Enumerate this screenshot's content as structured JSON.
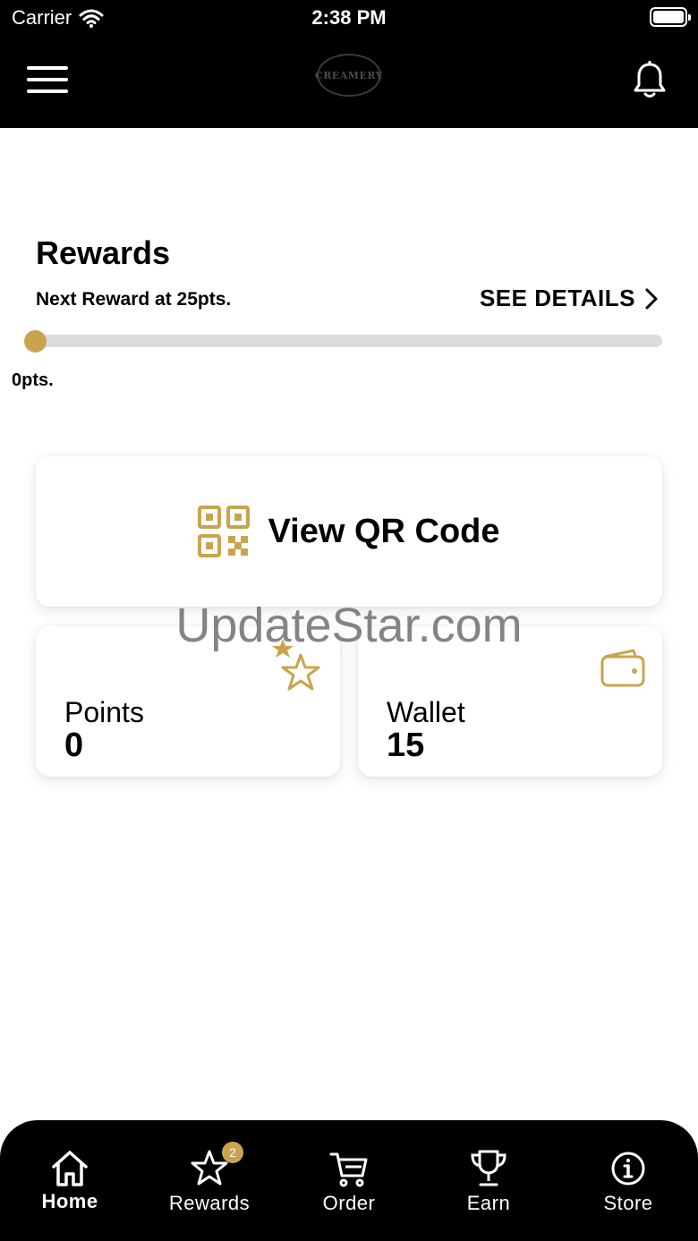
{
  "status_bar": {
    "carrier": "Carrier",
    "time": "2:38 PM"
  },
  "header": {
    "logo_text": "CREAMERY"
  },
  "rewards": {
    "title": "Rewards",
    "next_reward": "Next Reward at 25pts.",
    "see_details": "SEE DETAILS",
    "current_points_label": "0pts.",
    "progress_fraction": 0
  },
  "qr": {
    "label": "View QR Code"
  },
  "points_card": {
    "label": "Points",
    "value": "0"
  },
  "wallet_card": {
    "label": "Wallet",
    "value": "15"
  },
  "watermark": "UpdateStar.com",
  "bottom_nav": {
    "items": [
      {
        "label": "Home",
        "icon": "home-icon"
      },
      {
        "label": "Rewards",
        "icon": "star-icon",
        "badge": "2"
      },
      {
        "label": "Order",
        "icon": "cart-icon"
      },
      {
        "label": "Earn",
        "icon": "trophy-icon"
      },
      {
        "label": "Store",
        "icon": "info-icon"
      }
    ]
  },
  "colors": {
    "accent": "#c9a44e",
    "header_bg": "#000000",
    "track": "#dcdcdc"
  }
}
